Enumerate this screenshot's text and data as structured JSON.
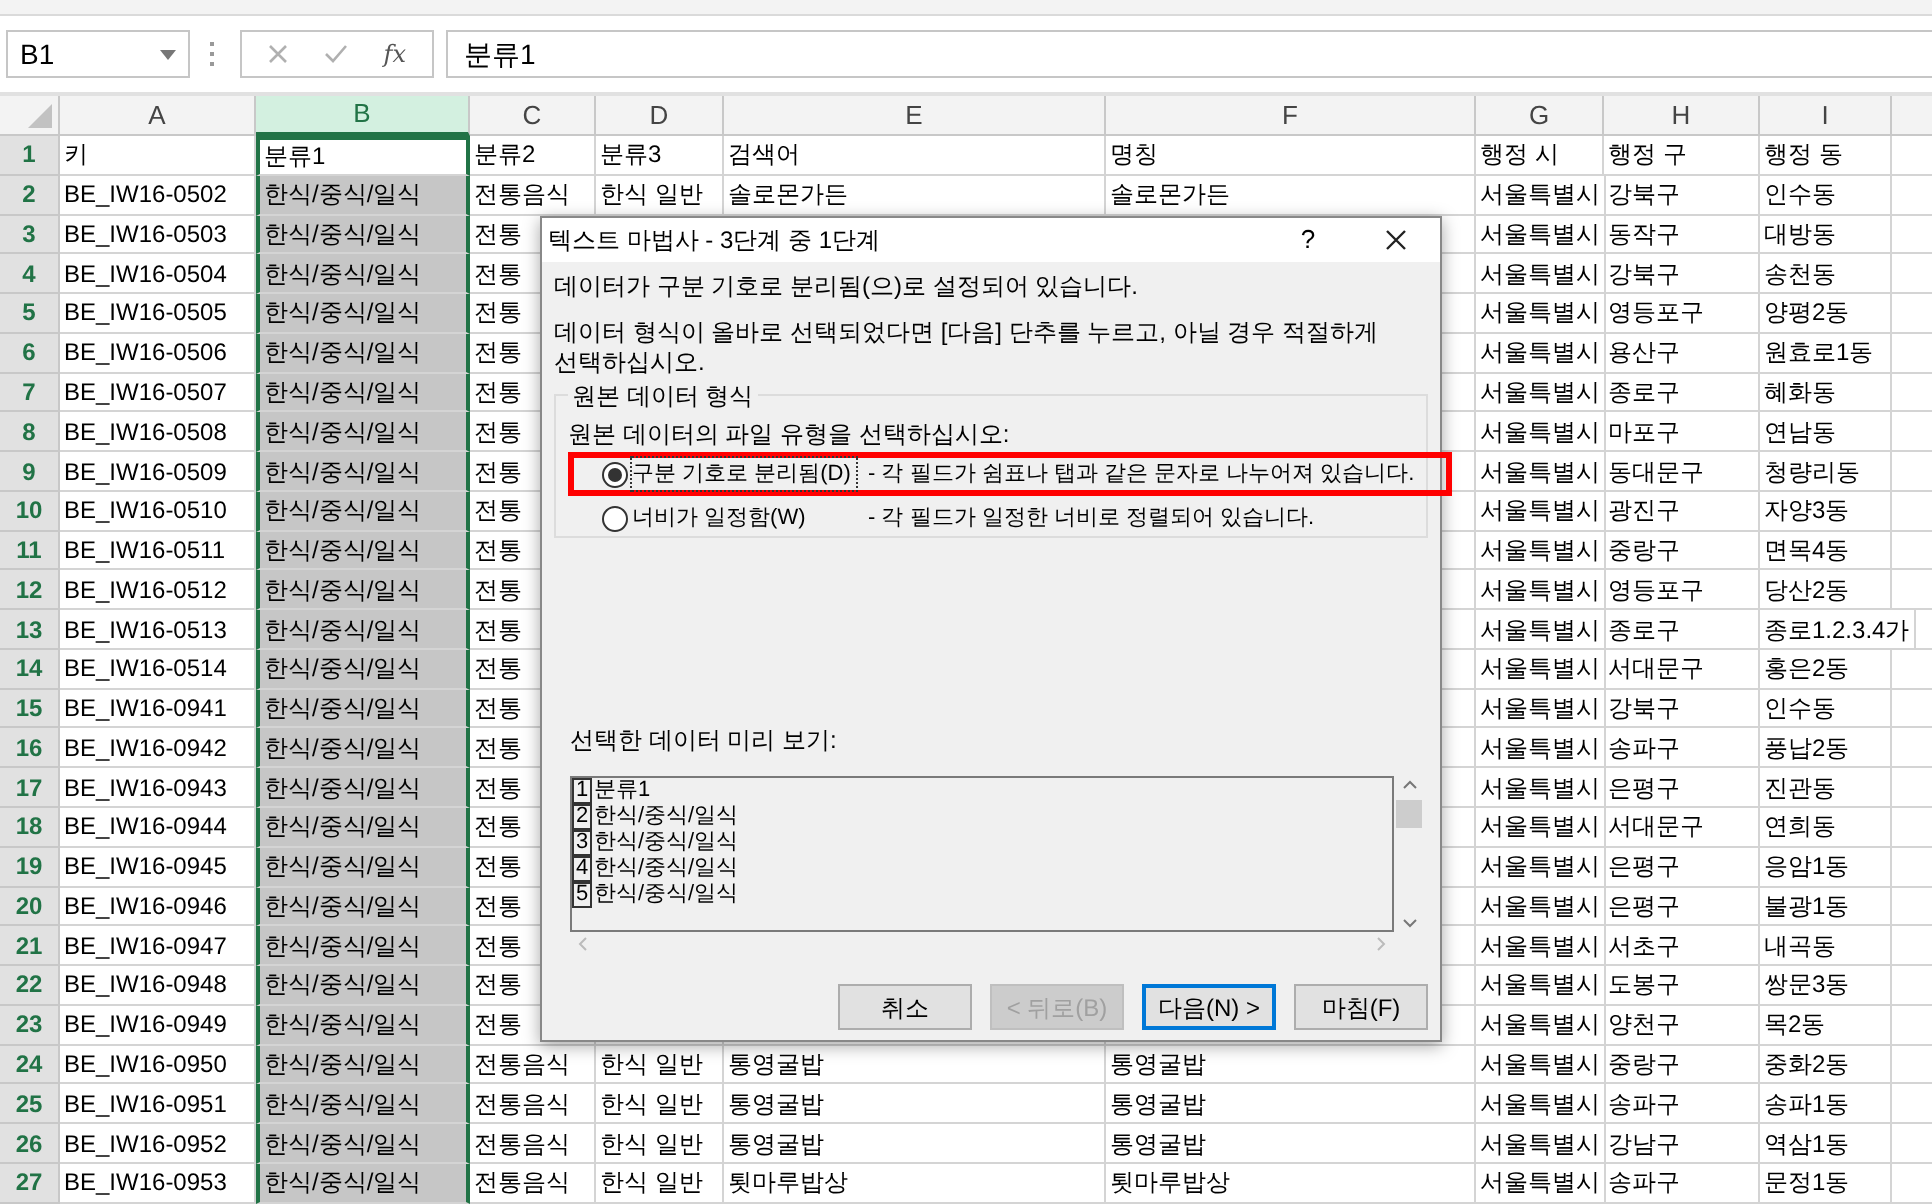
{
  "name_box": {
    "value": "B1"
  },
  "formula_bar": {
    "function_label": "fx",
    "value": "분류1"
  },
  "columns": [
    {
      "label": "A",
      "selected": false
    },
    {
      "label": "B",
      "selected": true
    },
    {
      "label": "C",
      "selected": false
    },
    {
      "label": "D",
      "selected": false
    },
    {
      "label": "E",
      "selected": false
    },
    {
      "label": "F",
      "selected": false
    },
    {
      "label": "G",
      "selected": false
    },
    {
      "label": "H",
      "selected": false
    },
    {
      "label": "I",
      "selected": false
    }
  ],
  "rows": [
    {
      "number": "1",
      "cells": {
        "a": "키",
        "b": "분류1",
        "c": "분류2",
        "d": "분류3",
        "e": "검색어",
        "f": "명칭",
        "g": "행정 시",
        "h": "행정 구",
        "i": "행정 동"
      }
    },
    {
      "number": "2",
      "cells": {
        "a": "BE_IW16-0502",
        "b": "한식/중식/일식",
        "c": "전통음식",
        "d": "한식 일반",
        "e": "솔로몬가든",
        "f": "솔로몬가든",
        "g": "서울특별시",
        "h": "강북구",
        "i": "인수동"
      }
    },
    {
      "number": "3",
      "cells": {
        "a": "BE_IW16-0503",
        "b": "한식/중식/일식",
        "c": "전통",
        "g": "서울특별시",
        "h": "동작구",
        "i": "대방동"
      }
    },
    {
      "number": "4",
      "cells": {
        "a": "BE_IW16-0504",
        "b": "한식/중식/일식",
        "c": "전통",
        "g": "서울특별시",
        "h": "강북구",
        "i": "송천동"
      }
    },
    {
      "number": "5",
      "cells": {
        "a": "BE_IW16-0505",
        "b": "한식/중식/일식",
        "c": "전통",
        "g": "서울특별시",
        "h": "영등포구",
        "i": "양평2동"
      }
    },
    {
      "number": "6",
      "cells": {
        "a": "BE_IW16-0506",
        "b": "한식/중식/일식",
        "c": "전통",
        "g": "서울특별시",
        "h": "용산구",
        "i": "원효로1동"
      }
    },
    {
      "number": "7",
      "cells": {
        "a": "BE_IW16-0507",
        "b": "한식/중식/일식",
        "c": "전통",
        "g": "서울특별시",
        "h": "종로구",
        "i": "혜화동"
      }
    },
    {
      "number": "8",
      "cells": {
        "a": "BE_IW16-0508",
        "b": "한식/중식/일식",
        "c": "전통",
        "g": "서울특별시",
        "h": "마포구",
        "i": "연남동"
      }
    },
    {
      "number": "9",
      "cells": {
        "a": "BE_IW16-0509",
        "b": "한식/중식/일식",
        "c": "전통",
        "g": "서울특별시",
        "h": "동대문구",
        "i": "청량리동"
      }
    },
    {
      "number": "10",
      "cells": {
        "a": "BE_IW16-0510",
        "b": "한식/중식/일식",
        "c": "전통",
        "g": "서울특별시",
        "h": "광진구",
        "i": "자양3동"
      }
    },
    {
      "number": "11",
      "cells": {
        "a": "BE_IW16-0511",
        "b": "한식/중식/일식",
        "c": "전통",
        "g": "서울특별시",
        "h": "중랑구",
        "i": "면목4동"
      }
    },
    {
      "number": "12",
      "cells": {
        "a": "BE_IW16-0512",
        "b": "한식/중식/일식",
        "c": "전통",
        "g": "서울특별시",
        "h": "영등포구",
        "i": "당산2동"
      }
    },
    {
      "number": "13",
      "cells": {
        "a": "BE_IW16-0513",
        "b": "한식/중식/일식",
        "c": "전통",
        "g": "서울특별시",
        "h": "종로구",
        "i": "종로1.2.3.4가"
      }
    },
    {
      "number": "14",
      "cells": {
        "a": "BE_IW16-0514",
        "b": "한식/중식/일식",
        "c": "전통",
        "g": "서울특별시",
        "h": "서대문구",
        "i": "홍은2동"
      }
    },
    {
      "number": "15",
      "cells": {
        "a": "BE_IW16-0941",
        "b": "한식/중식/일식",
        "c": "전통",
        "g": "서울특별시",
        "h": "강북구",
        "i": "인수동"
      }
    },
    {
      "number": "16",
      "cells": {
        "a": "BE_IW16-0942",
        "b": "한식/중식/일식",
        "c": "전통",
        "g": "서울특별시",
        "h": "송파구",
        "i": "풍납2동"
      }
    },
    {
      "number": "17",
      "cells": {
        "a": "BE_IW16-0943",
        "b": "한식/중식/일식",
        "c": "전통",
        "g": "서울특별시",
        "h": "은평구",
        "i": "진관동"
      }
    },
    {
      "number": "18",
      "cells": {
        "a": "BE_IW16-0944",
        "b": "한식/중식/일식",
        "c": "전통",
        "g": "서울특별시",
        "h": "서대문구",
        "i": "연희동"
      }
    },
    {
      "number": "19",
      "cells": {
        "a": "BE_IW16-0945",
        "b": "한식/중식/일식",
        "c": "전통",
        "g": "서울특별시",
        "h": "은평구",
        "i": "응암1동"
      }
    },
    {
      "number": "20",
      "cells": {
        "a": "BE_IW16-0946",
        "b": "한식/중식/일식",
        "c": "전통",
        "g": "서울특별시",
        "h": "은평구",
        "i": "불광1동"
      }
    },
    {
      "number": "21",
      "cells": {
        "a": "BE_IW16-0947",
        "b": "한식/중식/일식",
        "c": "전통",
        "g": "서울특별시",
        "h": "서초구",
        "i": "내곡동"
      }
    },
    {
      "number": "22",
      "cells": {
        "a": "BE_IW16-0948",
        "b": "한식/중식/일식",
        "c": "전통",
        "g": "서울특별시",
        "h": "도봉구",
        "i": "쌍문3동"
      }
    },
    {
      "number": "23",
      "cells": {
        "a": "BE_IW16-0949",
        "b": "한식/중식/일식",
        "c": "전통",
        "g": "서울특별시",
        "h": "양천구",
        "i": "목2동"
      }
    },
    {
      "number": "24",
      "cells": {
        "a": "BE_IW16-0950",
        "b": "한식/중식/일식",
        "c": "전통음식",
        "d": "한식 일반",
        "e": "통영굴밥",
        "f": "통영굴밥",
        "g": "서울특별시",
        "h": "중랑구",
        "i": "중화2동"
      }
    },
    {
      "number": "25",
      "cells": {
        "a": "BE_IW16-0951",
        "b": "한식/중식/일식",
        "c": "전통음식",
        "d": "한식 일반",
        "e": "통영굴밥",
        "f": "통영굴밥",
        "g": "서울특별시",
        "h": "송파구",
        "i": "송파1동"
      }
    },
    {
      "number": "26",
      "cells": {
        "a": "BE_IW16-0952",
        "b": "한식/중식/일식",
        "c": "전통음식",
        "d": "한식 일반",
        "e": "통영굴밥",
        "f": "통영굴밥",
        "g": "서울특별시",
        "h": "강남구",
        "i": "역삼1동"
      }
    },
    {
      "number": "27",
      "cells": {
        "a": "BE_IW16-0953",
        "b": "한식/중식/일식",
        "c": "전통음식",
        "d": "한식 일반",
        "e": "툇마루밥상",
        "f": "툇마루밥상",
        "g": "서울특별시",
        "h": "송파구",
        "i": "문정1동"
      }
    }
  ],
  "dialog": {
    "title": "텍스트 마법사 - 3단계 중 1단계",
    "help_button": "?",
    "messages": [
      "데이터가 구분 기호로 분리됨(으)로 설정되어 있습니다.",
      "데이터 형식이 올바로 선택되었다면 [다음] 단추를 누르고, 아닐 경우 적절하게 선택하십시오."
    ],
    "group": {
      "title": "원본 데이터 형식",
      "prompt": "원본 데이터의 파일 유형을 선택하십시오:",
      "options": [
        {
          "label": "구분 기호로 분리됨(D)",
          "description": "- 각 필드가 쉼표나 탭과 같은 문자로 나누어져 있습니다.",
          "selected": true,
          "highlighted": true
        },
        {
          "label": "너비가 일정함(W)",
          "description": "- 각 필드가 일정한 너비로 정렬되어 있습니다.",
          "selected": false
        }
      ]
    },
    "preview": {
      "label": "선택한 데이터 미리 보기:",
      "lines": [
        {
          "number": "1",
          "text": "분류1"
        },
        {
          "number": "2",
          "text": "한식/중식/일식"
        },
        {
          "number": "3",
          "text": "한식/중식/일식"
        },
        {
          "number": "4",
          "text": "한식/중식/일식"
        },
        {
          "number": "5",
          "text": "한식/중식/일식"
        }
      ]
    },
    "buttons": [
      {
        "label": "취소",
        "disabled": false,
        "default": false
      },
      {
        "label": "< 뒤로(B)",
        "disabled": true,
        "default": false
      },
      {
        "label": "다음(N) >",
        "disabled": false,
        "default": true
      },
      {
        "label": "마침(F)",
        "disabled": false,
        "default": false
      }
    ]
  }
}
